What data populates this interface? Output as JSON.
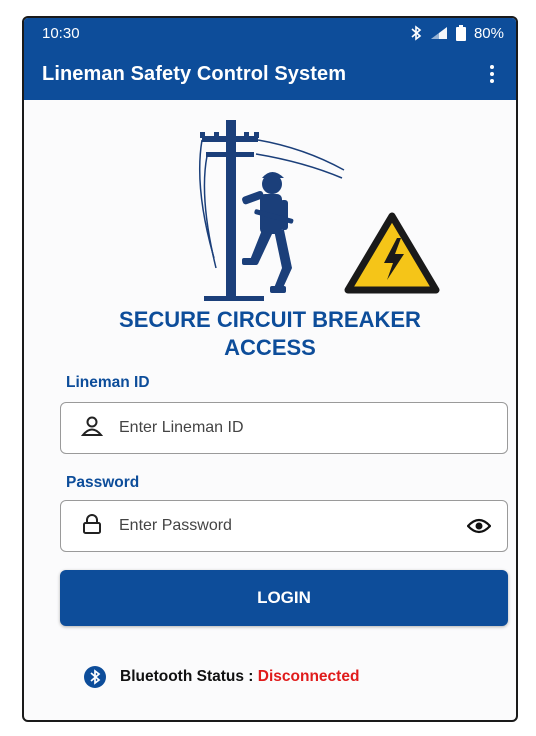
{
  "status_bar": {
    "time": "10:30",
    "battery": "80%",
    "icons": [
      "bluetooth-icon",
      "signal-icon",
      "battery-icon"
    ]
  },
  "app_bar": {
    "title": "Lineman Safety Control System",
    "menu_icon": "more-vert-icon"
  },
  "heading": {
    "line1": "SECURE CIRCUIT BREAKER",
    "line2": "ACCESS"
  },
  "lineman_id": {
    "label": "Lineman ID",
    "placeholder": "Enter Lineman ID",
    "value": "",
    "icon": "person-icon"
  },
  "password": {
    "label": "Password",
    "placeholder": "Enter Password",
    "value": "",
    "icon": "lock-icon",
    "toggle_icon": "eye-icon"
  },
  "login_button": {
    "label": "LOGIN"
  },
  "bluetooth": {
    "label": "Bluetooth Status :",
    "status": "Disconnected",
    "icon": "bluetooth-icon"
  },
  "colors": {
    "primary": "#0d4d9a",
    "warning_yellow": "#f5c518",
    "error_red": "#e01b1b"
  }
}
